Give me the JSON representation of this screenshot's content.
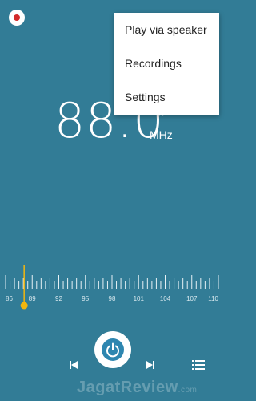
{
  "menu": {
    "items": [
      "Play via speaker",
      "Recordings",
      "Settings"
    ]
  },
  "tuner": {
    "frequency": "88.0",
    "unit": "MHz",
    "favorite_icon": "star-outline-icon",
    "current_frequency": 88.0
  },
  "dial": {
    "labels": [
      "86",
      "89",
      "92",
      "95",
      "98",
      "101",
      "104",
      "107",
      "110"
    ],
    "min": 86,
    "max": 110
  },
  "watermark": {
    "text": "JagatReview",
    "sub": ".com"
  },
  "colors": {
    "background": "#327c96",
    "indicator": "#f2b60f",
    "record_dot": "#d32a2a",
    "power_inner": "#2e86b0"
  },
  "icons": {
    "record": "record-icon",
    "previous": "skip-previous-icon",
    "power": "power-icon",
    "next": "skip-next-icon",
    "list": "list-icon"
  }
}
